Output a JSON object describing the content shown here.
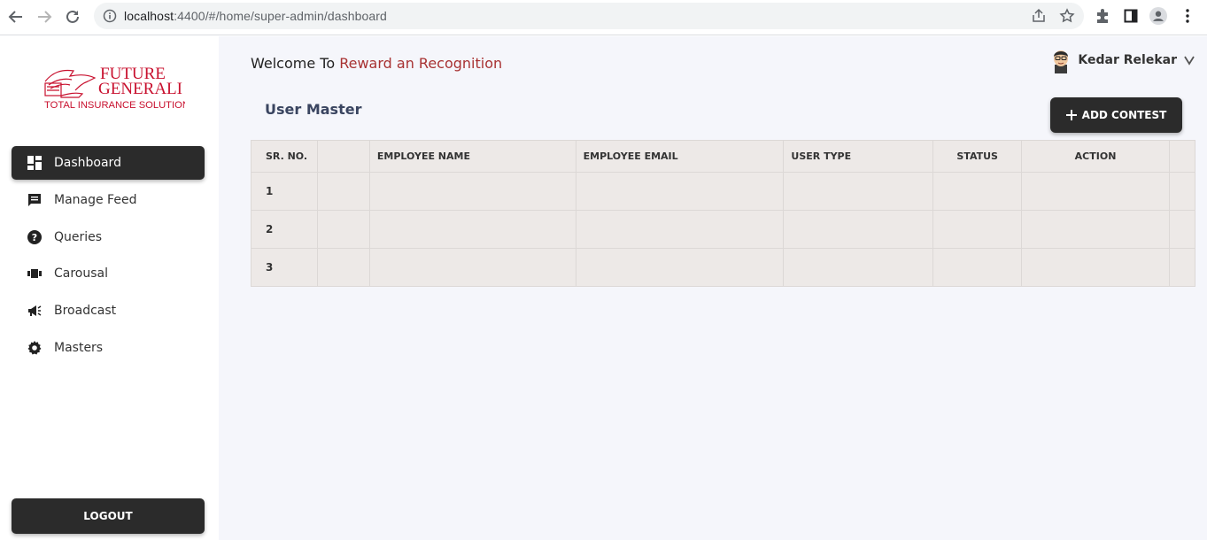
{
  "browser": {
    "url_host": "localhost",
    "url_path": ":4400/#/home/super-admin/dashboard"
  },
  "sidebar": {
    "logo_alt": "FUTURE GENERALI TOTAL INSURANCE SOLUTIONS",
    "logo_line1": "FUTURE",
    "logo_line2": "GENERALI",
    "logo_line3": "TOTAL INSURANCE SOLUTIONS",
    "items": [
      {
        "label": "Dashboard",
        "icon": "dashboard-icon",
        "active": true
      },
      {
        "label": "Manage Feed",
        "icon": "chat-icon"
      },
      {
        "label": "Queries",
        "icon": "help-icon"
      },
      {
        "label": "Carousal",
        "icon": "carousel-icon"
      },
      {
        "label": "Broadcast",
        "icon": "megaphone-icon"
      },
      {
        "label": "Masters",
        "icon": "gear-icon"
      }
    ],
    "logout_label": "LOGOUT"
  },
  "header": {
    "welcome_prefix": "Welcome To",
    "welcome_accent": "Reward an Recognition",
    "user_name": "Kedar Relekar"
  },
  "main": {
    "section_title": "User Master",
    "add_button_label": "ADD CONTEST",
    "table": {
      "headers": [
        "SR. NO.",
        "",
        "EMPLOYEE NAME",
        "EMPLOYEE EMAIL",
        "USER TYPE",
        "STATUS",
        "ACTION",
        ""
      ],
      "rows": [
        [
          "1",
          "",
          "",
          "",
          "",
          "",
          "",
          ""
        ],
        [
          "2",
          "",
          "",
          "",
          "",
          "",
          "",
          ""
        ],
        [
          "3",
          "",
          "",
          "",
          "",
          "",
          "",
          ""
        ]
      ]
    }
  },
  "colors": {
    "accent": "#a83232",
    "dark_button": "#2b2b2b",
    "table_bg": "#ede9e7",
    "main_bg": "#f5f6fb"
  }
}
